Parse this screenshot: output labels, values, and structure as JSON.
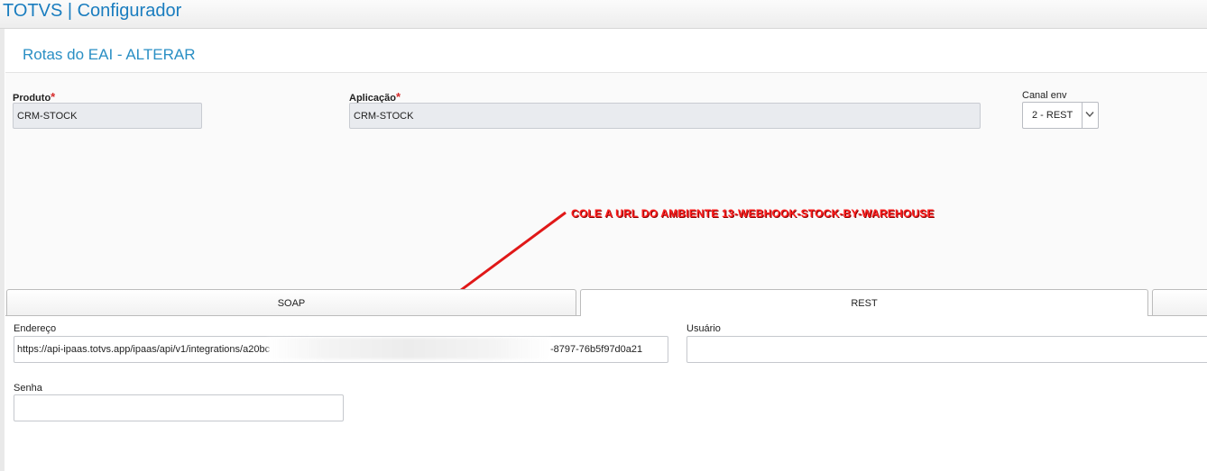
{
  "app": {
    "title": "TOTVS | Configurador"
  },
  "form": {
    "title": "Rotas do EAI - ALTERAR"
  },
  "fields": {
    "produto": {
      "label": "Produto",
      "required_mark": "*",
      "value": "CRM-STOCK"
    },
    "aplicacao": {
      "label": "Aplicação",
      "required_mark": "*",
      "value": "CRM-STOCK"
    },
    "canal_env": {
      "label": "Canal env",
      "value": "2 - REST"
    }
  },
  "annotation": {
    "text": "COLE A URL DO AMBIENTE 13-WEBHOOK-STOCK-BY-WAREHOUSE",
    "color": "#ff1f1f"
  },
  "tabs": [
    {
      "label": "SOAP",
      "active": false
    },
    {
      "label": "REST",
      "active": true
    }
  ],
  "rest": {
    "endereco": {
      "label": "Endereço",
      "value_start": "https://api-ipaas.totvs.app/ipaas/api/v1/integrations/a20bc",
      "value_end": "-8797-76b5f97d0a21"
    },
    "usuario": {
      "label": "Usuário",
      "value": ""
    },
    "senha": {
      "label": "Senha",
      "value": ""
    }
  },
  "colors": {
    "brand": "#1a7dbf",
    "form_title": "#2a8fc4",
    "required": "#d62b2b"
  }
}
